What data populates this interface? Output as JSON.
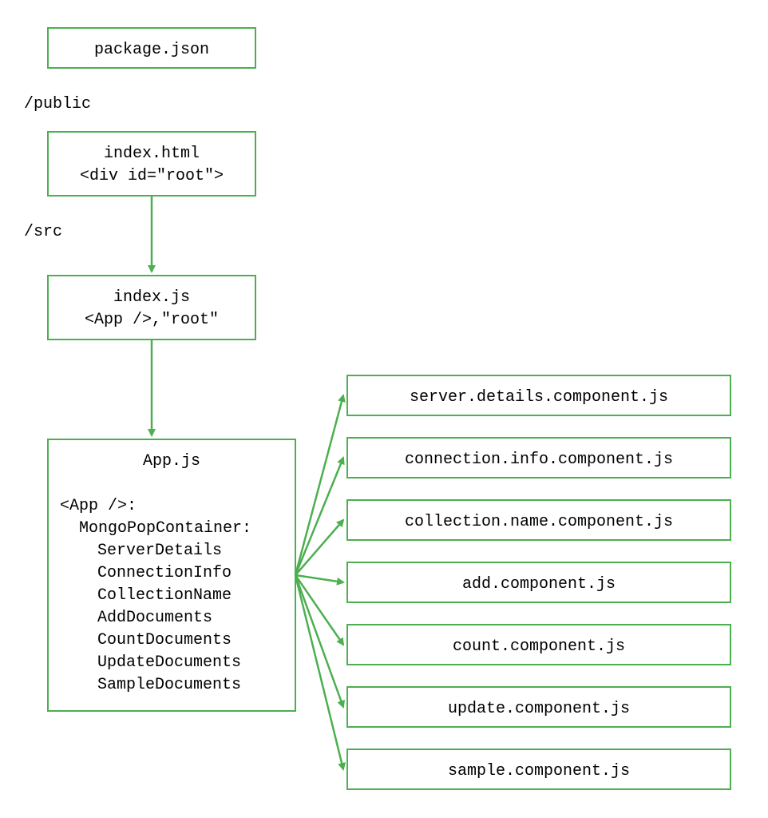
{
  "nodes": {
    "package": {
      "line1": "package.json"
    },
    "public_label": "/public",
    "index_html": {
      "line1": "index.html",
      "line2": "<div id=\"root\">"
    },
    "src_label": "/src",
    "index_js": {
      "line1": "index.js",
      "line2": "<App />,\"root\""
    },
    "app_js": {
      "line1": "App.js",
      "line2": "<App />:",
      "line3": "  MongoPopContainer:",
      "items": [
        "ServerDetails",
        "ConnectionInfo",
        "CollectionName",
        "AddDocuments",
        "CountDocuments",
        "UpdateDocuments",
        "SampleDocuments"
      ]
    },
    "components": [
      "server.details.component.js",
      "connection.info.component.js",
      "collection.name.component.js",
      "add.component.js",
      "count.component.js",
      "update.component.js",
      "sample.component.js"
    ]
  }
}
